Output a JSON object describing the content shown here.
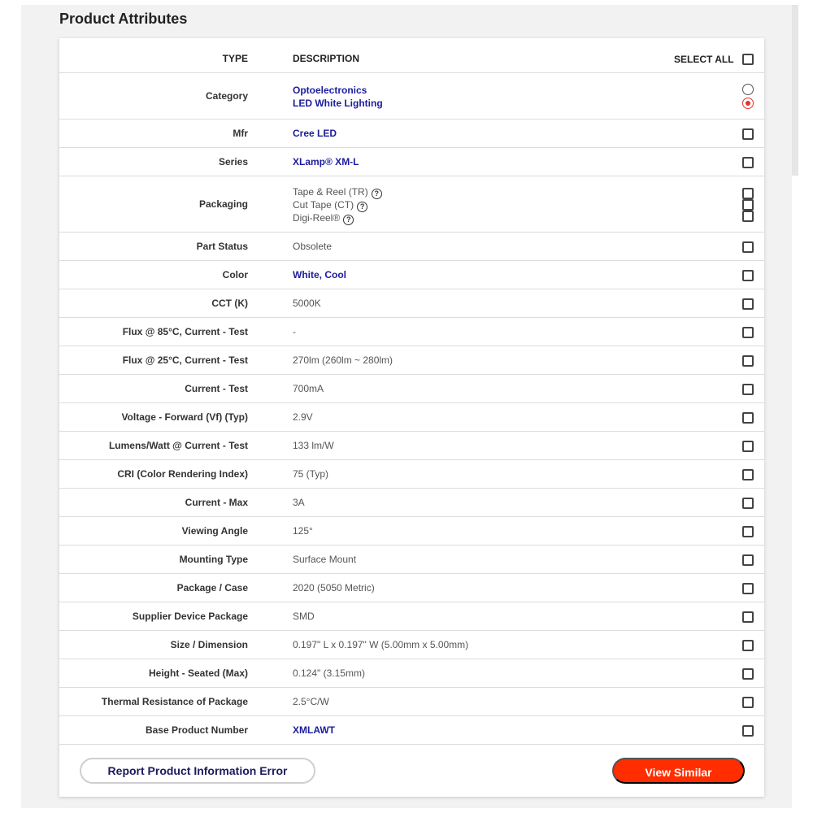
{
  "title": "Product Attributes",
  "header": {
    "type": "TYPE",
    "description": "DESCRIPTION",
    "select_all": "SELECT ALL"
  },
  "rows": [
    {
      "type": "Category",
      "desc_lines": [
        "Optoelectronics",
        "LED White Lighting"
      ],
      "link": true,
      "control": "radio",
      "selected_index": 1
    },
    {
      "type": "Mfr",
      "desc": "Cree LED",
      "link": true
    },
    {
      "type": "Series",
      "desc": "XLamp® XM-L",
      "link": true
    },
    {
      "type": "Packaging",
      "desc_lines": [
        "Tape & Reel (TR)",
        "Cut Tape (CT)",
        "Digi-Reel®"
      ],
      "help_icons": true,
      "control": "multi-checkbox"
    },
    {
      "type": "Part Status",
      "desc": "Obsolete"
    },
    {
      "type": "Color",
      "desc": "White, Cool",
      "link": true
    },
    {
      "type": "CCT (K)",
      "desc": "5000K"
    },
    {
      "type": "Flux @ 85°C, Current - Test",
      "desc": "-"
    },
    {
      "type": "Flux @ 25°C, Current - Test",
      "desc": "270lm (260lm ~ 280lm)"
    },
    {
      "type": "Current - Test",
      "desc": "700mA"
    },
    {
      "type": "Voltage - Forward (Vf) (Typ)",
      "desc": "2.9V"
    },
    {
      "type": "Lumens/Watt @ Current - Test",
      "desc": "133 lm/W"
    },
    {
      "type": "CRI (Color Rendering Index)",
      "desc": "75 (Typ)"
    },
    {
      "type": "Current - Max",
      "desc": "3A"
    },
    {
      "type": "Viewing Angle",
      "desc": "125°"
    },
    {
      "type": "Mounting Type",
      "desc": "Surface Mount"
    },
    {
      "type": "Package / Case",
      "desc": "2020 (5050 Metric)"
    },
    {
      "type": "Supplier Device Package",
      "desc": "SMD"
    },
    {
      "type": "Size / Dimension",
      "desc": "0.197\" L x 0.197\" W (5.00mm x 5.00mm)"
    },
    {
      "type": "Height - Seated (Max)",
      "desc": "0.124\" (3.15mm)"
    },
    {
      "type": "Thermal Resistance of Package",
      "desc": "2.5°C/W"
    },
    {
      "type": "Base Product Number",
      "desc": "XMLAWT",
      "link": true
    }
  ],
  "buttons": {
    "report": "Report Product Information Error",
    "view_similar": "View Similar"
  },
  "colors": {
    "accent": "#ff2d00",
    "link": "#1c1c9c",
    "radio_selected": "#e8322a"
  },
  "icons": {
    "help": "question-circle-icon"
  }
}
